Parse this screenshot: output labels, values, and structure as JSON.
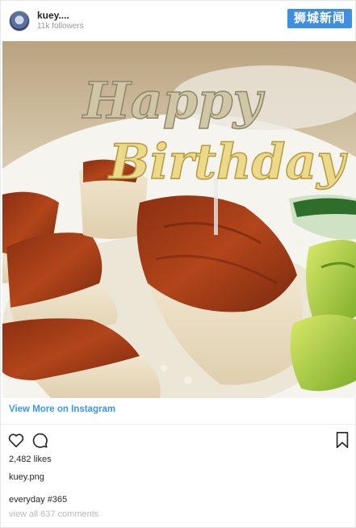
{
  "header": {
    "username": "kuey....",
    "followers": "11k followers",
    "watermark": "狮城新闻"
  },
  "photo": {
    "topper_line1": "Happy",
    "topper_line2": "Birthday"
  },
  "view_more": "View More on Instagram",
  "actions": {
    "like_icon": "heart-outline",
    "comment_icon": "speech-bubble",
    "save_icon": "bookmark"
  },
  "likes": "2,482 likes",
  "caption_user": "kuey.png",
  "caption": "everyday #365",
  "comments_link": "view all 637 comments",
  "colors": {
    "link": "#3897f0",
    "watermark_bg": "#3f8fde",
    "topper_gold": "#e8d48a"
  }
}
